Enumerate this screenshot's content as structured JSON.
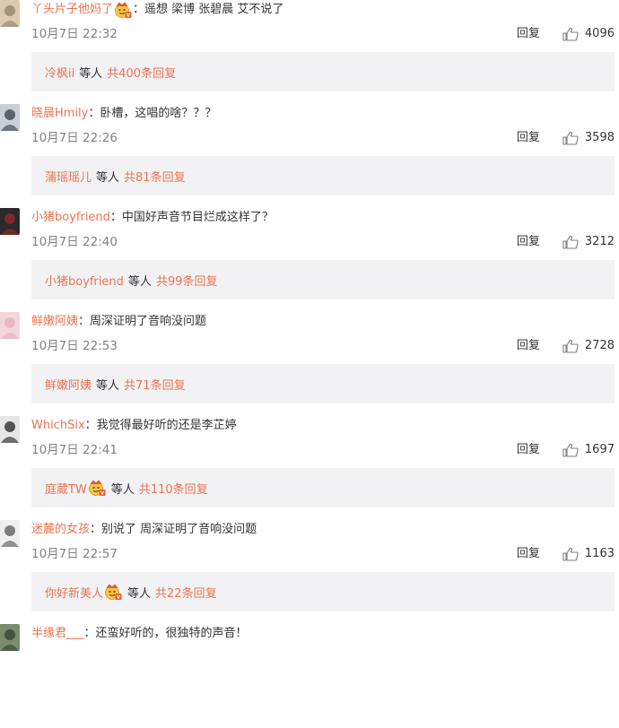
{
  "comments": [
    {
      "username": "丫头片子他妈了",
      "badge": "vip-badge-icon",
      "text": "：遥想  梁博 张碧晨 艾不说了",
      "time": "10月7日 22:32",
      "reply_label": "回复",
      "likes": "4096",
      "replies": {
        "user": "冷枫ii",
        "badge": "",
        "etc": "等人",
        "total": "共400条回复"
      },
      "avatar_colors": [
        "#d8cbb0",
        "#9b8a70"
      ]
    },
    {
      "username": "晓晨Hmily",
      "badge": "",
      "text": "：卧槽，这唱的啥？？？",
      "time": "10月7日 22:26",
      "reply_label": "回复",
      "likes": "3598",
      "replies": {
        "user": "蒲瑶瑶儿",
        "badge": "",
        "etc": "等人",
        "total": "共81条回复"
      },
      "avatar_colors": [
        "#c9cfd6",
        "#4a4f55"
      ]
    },
    {
      "username": "小猪boyfriend",
      "badge": "",
      "text": "：中国好声音节目烂成这样了？",
      "time": "10月7日 22:40",
      "reply_label": "回复",
      "likes": "3212",
      "replies": {
        "user": "小猪boyfriend",
        "badge": "",
        "etc": "等人",
        "total": "共99条回复"
      },
      "avatar_colors": [
        "#2a2a2a",
        "#8a2a2a"
      ]
    },
    {
      "username": "鲜嫩阿姨",
      "badge": "",
      "text": "：周深证明了音响没问题",
      "time": "10月7日 22:53",
      "reply_label": "回复",
      "likes": "2728",
      "replies": {
        "user": "鲜嫩阿姨",
        "badge": "",
        "etc": "等人",
        "total": "共71条回复"
      },
      "avatar_colors": [
        "#f3d6dc",
        "#e7b3c0"
      ]
    },
    {
      "username": "WhichSix",
      "badge": "",
      "text": "：我觉得最好听的还是李芷婷",
      "time": "10月7日 22:41",
      "reply_label": "回复",
      "likes": "1697",
      "replies": {
        "user": "庭葳TW",
        "badge": "vip-badge-icon",
        "etc": "等人",
        "total": "共110条回复"
      },
      "avatar_colors": [
        "#e6e6e6",
        "#3a3a3a"
      ]
    },
    {
      "username": "迷麓的女孩",
      "badge": "",
      "text": "：别说了 周深证明了音响没问题",
      "time": "10月7日 22:57",
      "reply_label": "回复",
      "likes": "1163",
      "replies": {
        "user": "你好新美人",
        "badge": "vip-badge-icon",
        "etc": "等人",
        "total": "共22条回复"
      },
      "avatar_colors": [
        "#efefef",
        "#6a6a6a"
      ]
    },
    {
      "username": "半缘君___",
      "badge": "",
      "text": "：还蛮好听的，很独特的声音！",
      "time": "",
      "reply_label": "",
      "likes": "",
      "replies": null,
      "avatar_colors": [
        "#7c8a6e",
        "#3b4a38"
      ]
    }
  ],
  "colors": {
    "username": "#eb7350",
    "meta": "#808080",
    "reply_box_bg": "#f2f2f5"
  }
}
